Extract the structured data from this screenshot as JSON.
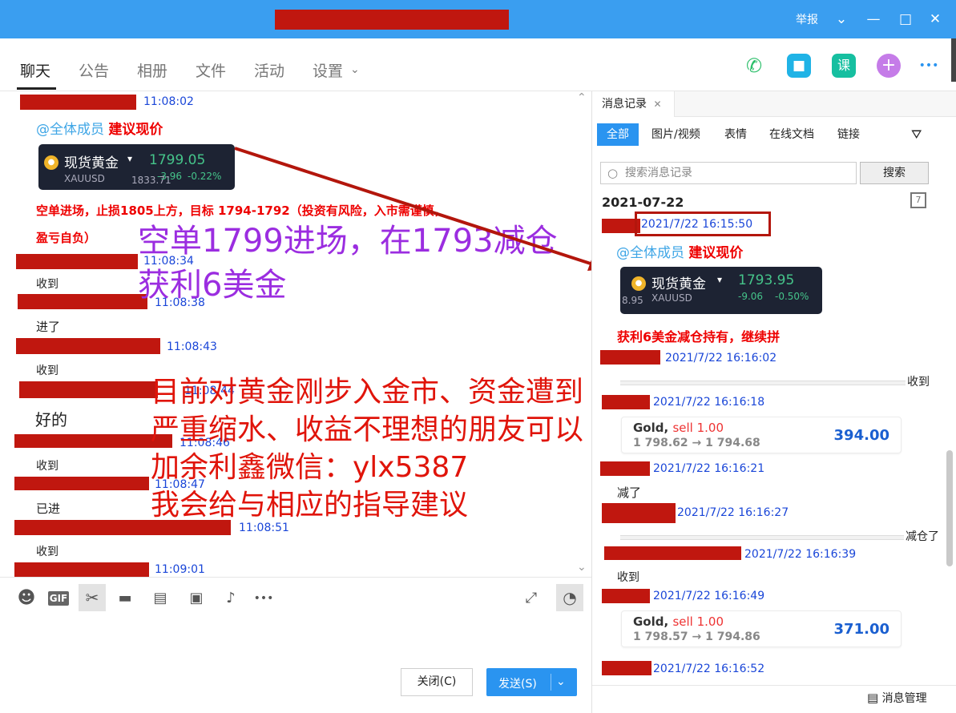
{
  "titlebar": {
    "report": "举报",
    "chevron": "⌄",
    "minimize": "—",
    "maximize": "□",
    "close": "✕"
  },
  "tabs": [
    "聊天",
    "公告",
    "相册",
    "文件",
    "活动",
    "设置"
  ],
  "tab_icons": {
    "phone": "✆",
    "video": "■",
    "course": "课",
    "add": "+",
    "more": "•••"
  },
  "chat": {
    "messages": [
      {
        "time": "11:08:02"
      },
      {
        "mention": "@全体成员",
        "highlight": "建议现价"
      },
      {
        "time": "11:08:34",
        "text": "收到"
      },
      {
        "time": "11:08:38",
        "text": "进了"
      },
      {
        "time": "11:08:43",
        "text": "收到"
      },
      {
        "time": "11:08:44",
        "text": "好的"
      },
      {
        "time": "11:08:46",
        "text": "收到"
      },
      {
        "time": "11:08:47",
        "text": "已进"
      },
      {
        "time": "11:08:51",
        "text": "收到"
      },
      {
        "time": "11:09:01"
      }
    ],
    "quote_card": {
      "name": "现货黄金",
      "symbol": "XAUUSD",
      "price": "1799.05",
      "change": "-3.96",
      "pct": "-0.22%",
      "prev": "1833.71"
    },
    "signal_line1": "空单进场，止损1805上方，目标 1794-1792（投资有风险，入市需谨慎，",
    "signal_line2": "盈亏自负）"
  },
  "overlay": {
    "purple_line1": "空单1799进场，在1793减仓",
    "purple_line2": "获利6美金",
    "red_lines": [
      "目前对黄金刚步入金市、资金遭到",
      "严重缩水、收益不理想的朋友可以",
      "加余利鑫微信：ylx5387",
      "我会给与相应的指导建议"
    ]
  },
  "composer": {
    "close_label": "关闭(C)",
    "send_label": "发送(S)",
    "send_menu": "⌄"
  },
  "right_panel": {
    "tab_label": "消息记录",
    "tab_close": "✕",
    "filters": [
      "全部",
      "图片/视频",
      "表情",
      "在线文档",
      "链接"
    ],
    "search_placeholder": "搜索消息记录",
    "search_button": "搜索",
    "date": "2021-07-22",
    "rec1": {
      "time": "2021/7/22 16:15:50",
      "mention": "@全体成员",
      "highlight": "建议现价"
    },
    "quote_card": {
      "name": "现货黄金",
      "symbol": "XAUUSD",
      "price": "1793.95",
      "change": "-9.06",
      "pct": "-0.50%",
      "prev": "8.95"
    },
    "profit_note": "获利6美金减仓持有，继续拼",
    "rec2": {
      "time": "2021/7/22 16:16:02",
      "text": "收到"
    },
    "rec3": {
      "time": "2021/7/22 16:16:18"
    },
    "trade1": {
      "label": "Gold,",
      "side": "sell 1.00",
      "prices": "1 798.62 → 1 794.68",
      "amount": "394.00"
    },
    "rec4": {
      "time": "2021/7/22 16:16:21",
      "text": "减了"
    },
    "rec5": {
      "time": "2021/7/22 16:16:27",
      "text": "减仓了"
    },
    "rec6": {
      "time": "2021/7/22 16:16:39",
      "text": "收到"
    },
    "rec7": {
      "time": "2021/7/22 16:16:49"
    },
    "trade2": {
      "label": "Gold,",
      "side": "sell 1.00",
      "prices": "1 798.57 → 1 794.86",
      "amount": "371.00"
    },
    "rec8": {
      "time": "2021/7/22 16:16:52"
    },
    "manage_label": "消息管理"
  },
  "colors": {
    "titlebar": "#3a9ef0",
    "redaction": "#c0170f",
    "accent": "#2a94f0",
    "time_blue": "#1a46d8",
    "purple_overlay": "#9b2de0",
    "red_overlay": "#e0140a"
  }
}
